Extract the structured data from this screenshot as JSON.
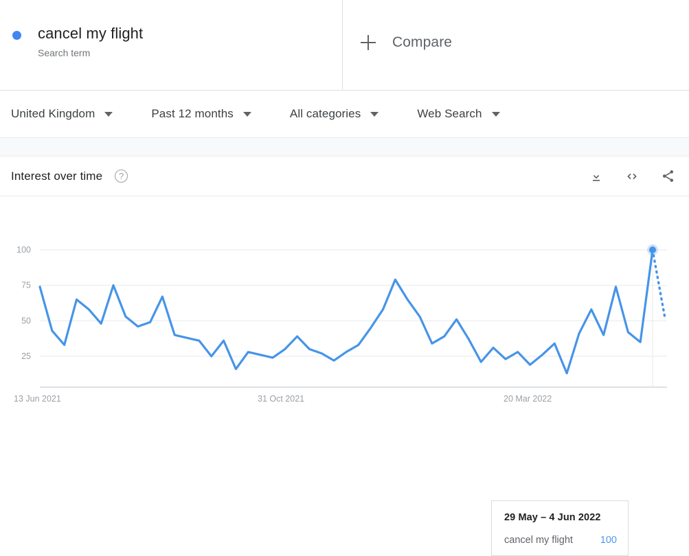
{
  "term": {
    "title": "cancel my flight",
    "subtitle": "Search term",
    "dot_color": "#4285f4"
  },
  "compare": {
    "label": "Compare",
    "icon": "plus-icon"
  },
  "filters": [
    {
      "label": "United Kingdom",
      "name": "filter-location"
    },
    {
      "label": "Past 12 months",
      "name": "filter-time-range"
    },
    {
      "label": "All categories",
      "name": "filter-category"
    },
    {
      "label": "Web Search",
      "name": "filter-search-type"
    }
  ],
  "card": {
    "title": "Interest over time",
    "help_icon": "?",
    "actions": [
      {
        "name": "download-icon",
        "label": "Download"
      },
      {
        "name": "embed-code-icon",
        "label": "Embed"
      },
      {
        "name": "share-icon",
        "label": "Share"
      }
    ]
  },
  "tooltip": {
    "date_range": "29 May – 4 Jun 2022",
    "series_label": "cancel my flight",
    "value": "100"
  },
  "chart_data": {
    "type": "line",
    "title": "Interest over time",
    "xlabel": "",
    "ylabel": "",
    "ylim": [
      0,
      100
    ],
    "yticks": [
      25,
      50,
      75,
      100
    ],
    "ytick_labels": [
      "25",
      "50",
      "75",
      "100"
    ],
    "grid": true,
    "legend": "none",
    "line_color": "#4694e8",
    "xtick_labels": [
      "13 Jun 2021",
      "31 Oct 2021",
      "20 Mar 2022"
    ],
    "xtick_positions": [
      0,
      20,
      40
    ],
    "series": [
      {
        "name": "cancel my flight",
        "values": [
          74,
          43,
          33,
          65,
          58,
          48,
          75,
          53,
          46,
          49,
          67,
          40,
          38,
          36,
          25,
          36,
          16,
          28,
          26,
          24,
          30,
          39,
          30,
          27,
          22,
          28,
          33,
          45,
          58,
          79,
          65,
          53,
          34,
          39,
          51,
          37,
          21,
          31,
          23,
          28,
          19,
          26,
          34,
          13,
          41,
          58,
          40,
          74,
          42,
          35,
          100
        ],
        "partial_tail": {
          "from_value": 100,
          "to_value": 52,
          "style": "dotted"
        },
        "highlight_index": 50,
        "highlight_value": 100
      }
    ],
    "annotations": [
      {
        "type": "hover-line",
        "x_index": 50
      },
      {
        "type": "point-marker",
        "x_index": 50,
        "value": 100
      }
    ]
  }
}
